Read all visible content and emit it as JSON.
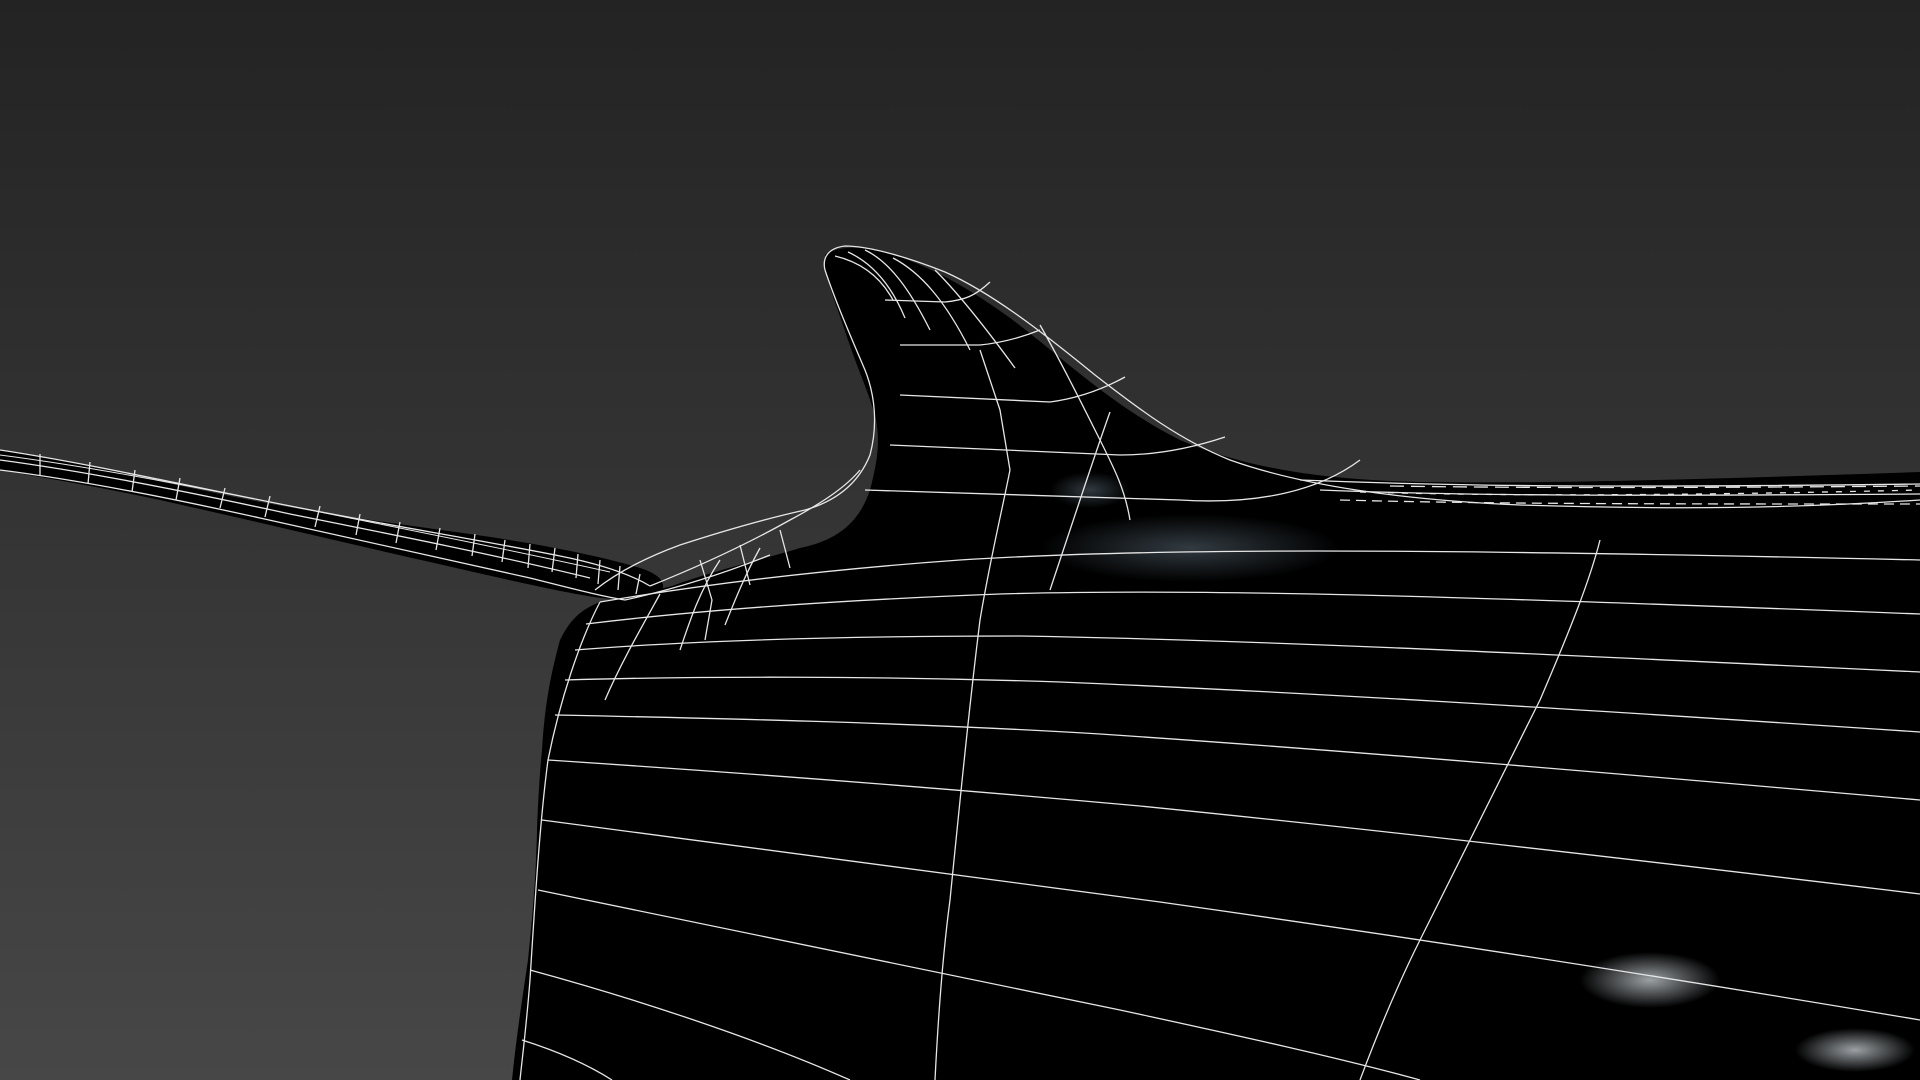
{
  "viewport": {
    "background_top": "#232323",
    "background_bottom": "#474747",
    "mesh_fill": "#000000",
    "wire_color": "#e6e6e6"
  }
}
